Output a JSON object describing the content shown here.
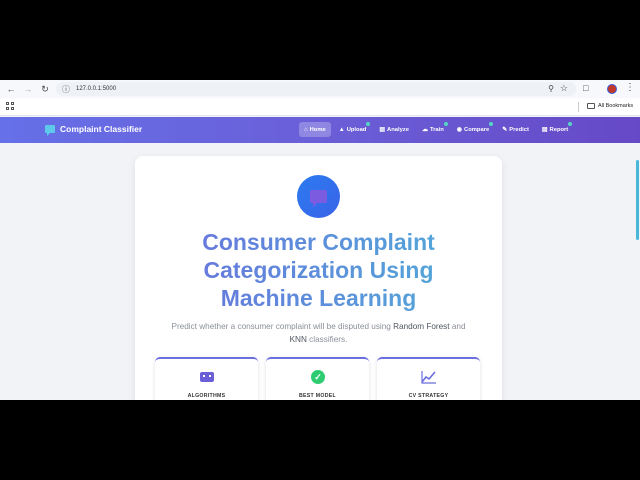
{
  "browser": {
    "url": "127.0.0.1:5000",
    "bookmarks_label": "All Bookmarks"
  },
  "navbar": {
    "brand": "Complaint Classifier",
    "links": [
      {
        "label": "Home",
        "icon": "home-icon",
        "active": true,
        "dot": false
      },
      {
        "label": "Upload",
        "icon": "upload-icon",
        "active": false,
        "dot": true
      },
      {
        "label": "Analyze",
        "icon": "chart-icon",
        "active": false,
        "dot": false
      },
      {
        "label": "Train",
        "icon": "cloud-icon",
        "active": false,
        "dot": true
      },
      {
        "label": "Compare",
        "icon": "compare-icon",
        "active": false,
        "dot": true
      },
      {
        "label": "Predict",
        "icon": "wand-icon",
        "active": false,
        "dot": false
      },
      {
        "label": "Report",
        "icon": "file-icon",
        "active": false,
        "dot": true
      }
    ]
  },
  "hero": {
    "title_line1": "Consumer Complaint",
    "title_line2": "Categorization Using",
    "title_line3": "Machine Learning",
    "subtitle_a": "Predict whether a consumer complaint will be disputed using ",
    "subtitle_b": "Random Forest",
    "subtitle_c": " and",
    "subtitle_d": "KNN",
    "subtitle_e": " classifiers."
  },
  "stats": [
    {
      "label": "ALGORITHMS",
      "icon": "robot-icon"
    },
    {
      "label": "BEST MODEL",
      "icon": "check-circle-icon"
    },
    {
      "label": "CV STRATEGY",
      "icon": "line-chart-icon"
    }
  ],
  "colors": {
    "accent": "#6670e8",
    "accent_dark": "#6649c6",
    "teal": "#55d6c2",
    "title_gradient_start": "#6b6ede",
    "title_gradient_end": "#4fb0d8"
  }
}
